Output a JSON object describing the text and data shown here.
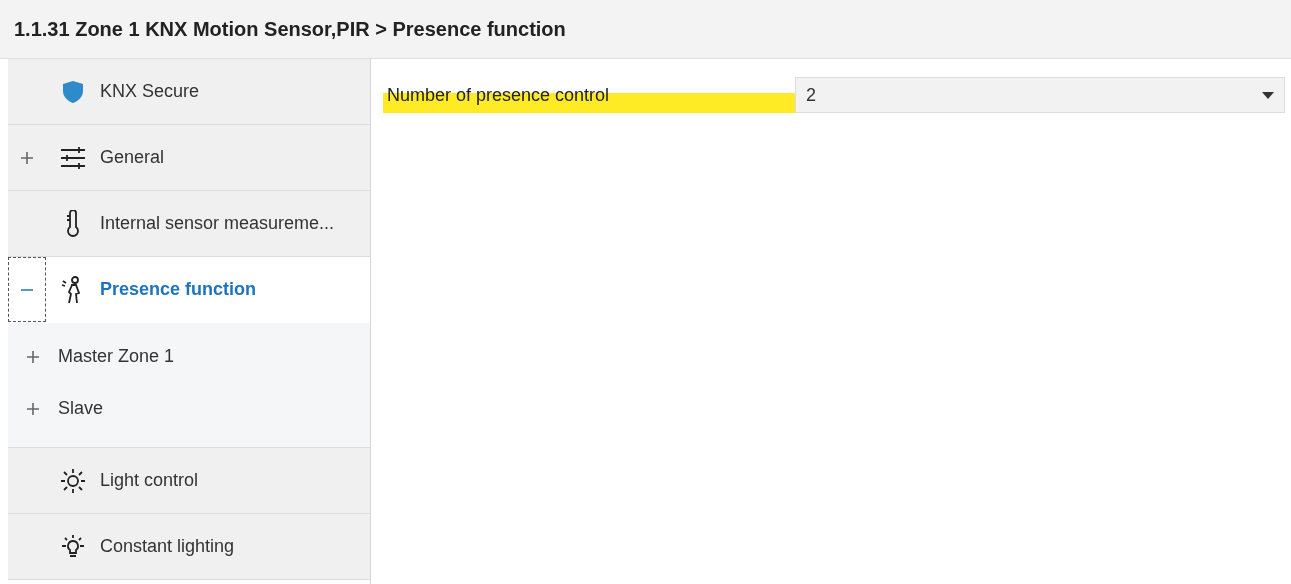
{
  "window": {
    "title": "1.1.31 Zone 1 KNX Motion Sensor,PIR > Presence function"
  },
  "sidebar": {
    "items": [
      {
        "label": "KNX Secure",
        "selected": false
      },
      {
        "label": "General",
        "selected": false,
        "expanded": false
      },
      {
        "label": "Internal sensor measureme...",
        "selected": false
      },
      {
        "label": "Presence function",
        "selected": true,
        "expanded": true,
        "children": [
          {
            "label": "Master Zone 1",
            "expanded": false
          },
          {
            "label": "Slave",
            "expanded": false
          }
        ]
      },
      {
        "label": "Light control",
        "selected": false
      },
      {
        "label": "Constant lighting",
        "selected": false
      }
    ]
  },
  "content": {
    "fields": [
      {
        "label": "Number of presence control",
        "value": "2",
        "highlighted": true
      }
    ]
  }
}
